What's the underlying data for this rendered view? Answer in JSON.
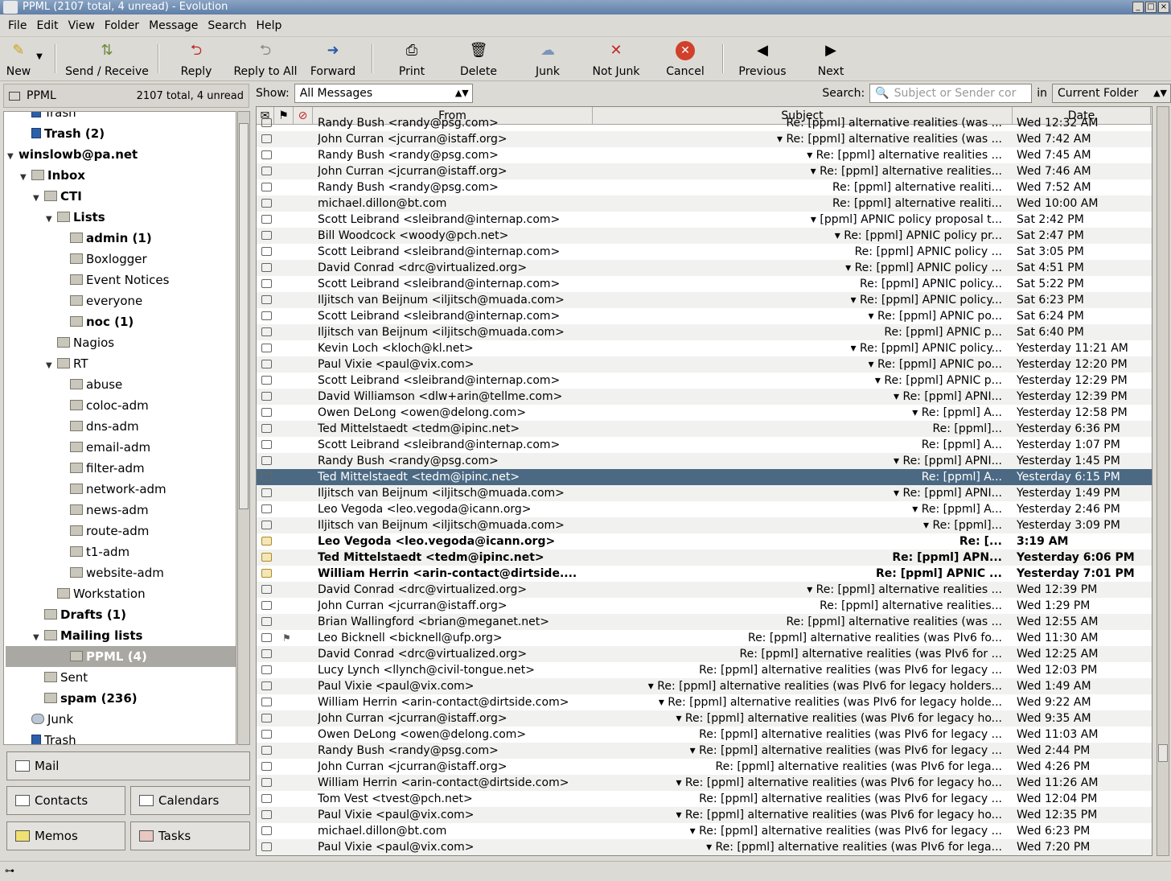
{
  "window": {
    "title": "PPML (2107 total, 4 unread) - Evolution"
  },
  "menu": [
    "File",
    "Edit",
    "View",
    "Folder",
    "Message",
    "Search",
    "Help"
  ],
  "toolbar": {
    "new": "New",
    "send_receive": "Send / Receive",
    "reply": "Reply",
    "reply_all": "Reply to All",
    "forward": "Forward",
    "print": "Print",
    "delete": "Delete",
    "junk": "Junk",
    "not_junk": "Not Junk",
    "cancel": "Cancel",
    "previous": "Previous",
    "next": "Next"
  },
  "folder_header": {
    "name": "PPML",
    "count": "2107 total, 4 unread"
  },
  "folders": [
    {
      "label": "Trash",
      "indent": 1,
      "bold": false,
      "icon": "trash-icon"
    },
    {
      "label": "Trash (2)",
      "indent": 1,
      "bold": true,
      "icon": "trash-icon"
    },
    {
      "label": "winslowb@pa.net",
      "indent": 0,
      "bold": true,
      "expander": "▼",
      "icon": ""
    },
    {
      "label": "Inbox",
      "indent": 1,
      "bold": true,
      "expander": "▼",
      "icon": "inbox-icon"
    },
    {
      "label": "CTI",
      "indent": 2,
      "bold": true,
      "expander": "▼",
      "icon": "folder-icon"
    },
    {
      "label": "Lists",
      "indent": 3,
      "bold": true,
      "expander": "▼",
      "icon": "folder-icon"
    },
    {
      "label": "admin (1)",
      "indent": 4,
      "bold": true,
      "icon": "folder-icon"
    },
    {
      "label": "Boxlogger",
      "indent": 4,
      "bold": false,
      "icon": "folder-icon"
    },
    {
      "label": "Event Notices",
      "indent": 4,
      "bold": false,
      "icon": "folder-icon"
    },
    {
      "label": "everyone",
      "indent": 4,
      "bold": false,
      "icon": "folder-icon"
    },
    {
      "label": "noc (1)",
      "indent": 4,
      "bold": true,
      "icon": "folder-icon"
    },
    {
      "label": "Nagios",
      "indent": 3,
      "bold": false,
      "icon": "folder-icon"
    },
    {
      "label": "RT",
      "indent": 3,
      "bold": false,
      "expander": "▼",
      "icon": "folder-icon"
    },
    {
      "label": "abuse",
      "indent": 4,
      "bold": false,
      "icon": "folder-icon"
    },
    {
      "label": "coloc-adm",
      "indent": 4,
      "bold": false,
      "icon": "folder-icon"
    },
    {
      "label": "dns-adm",
      "indent": 4,
      "bold": false,
      "icon": "folder-icon"
    },
    {
      "label": "email-adm",
      "indent": 4,
      "bold": false,
      "icon": "folder-icon"
    },
    {
      "label": "filter-adm",
      "indent": 4,
      "bold": false,
      "icon": "folder-icon"
    },
    {
      "label": "network-adm",
      "indent": 4,
      "bold": false,
      "icon": "folder-icon"
    },
    {
      "label": "news-adm",
      "indent": 4,
      "bold": false,
      "icon": "folder-icon"
    },
    {
      "label": "route-adm",
      "indent": 4,
      "bold": false,
      "icon": "folder-icon"
    },
    {
      "label": "t1-adm",
      "indent": 4,
      "bold": false,
      "icon": "folder-icon"
    },
    {
      "label": "website-adm",
      "indent": 4,
      "bold": false,
      "icon": "folder-icon"
    },
    {
      "label": "Workstation",
      "indent": 3,
      "bold": false,
      "icon": "folder-icon"
    },
    {
      "label": "Drafts (1)",
      "indent": 2,
      "bold": true,
      "icon": "folder-icon"
    },
    {
      "label": "Mailing lists",
      "indent": 2,
      "bold": true,
      "expander": "▼",
      "icon": "folder-icon"
    },
    {
      "label": "PPML (4)",
      "indent": 3,
      "bold": true,
      "icon": "folder-icon",
      "selected": true
    },
    {
      "label": "Sent",
      "indent": 2,
      "bold": false,
      "icon": "folder-icon"
    },
    {
      "label": "spam (236)",
      "indent": 2,
      "bold": true,
      "icon": "folder-icon"
    },
    {
      "label": "Junk",
      "indent": 1,
      "bold": false,
      "icon": "junk-icon"
    },
    {
      "label": "Trash",
      "indent": 1,
      "bold": false,
      "icon": "trash-icon"
    }
  ],
  "switcher": {
    "mail": "Mail",
    "contacts": "Contacts",
    "calendars": "Calendars",
    "memos": "Memos",
    "tasks": "Tasks"
  },
  "filter": {
    "show_label": "Show:",
    "show_value": "All Messages",
    "search_label": "Search:",
    "search_placeholder": "Subject or Sender cor",
    "in_label": "in",
    "scope_value": "Current Folder"
  },
  "columns": {
    "from": "From",
    "subject": "Subject",
    "date": "Date"
  },
  "messages": [
    {
      "from": "Randy Bush <randy@psg.com>",
      "subject": "Re: [ppml] alternative realities (was ...",
      "date": "Wed 12:32 AM",
      "thread": false
    },
    {
      "from": "John Curran <jcurran@istaff.org>",
      "subject": "Re: [ppml] alternative realities (was ...",
      "date": "Wed 7:42 AM",
      "thread": true
    },
    {
      "from": "Randy Bush <randy@psg.com>",
      "subject": "Re: [ppml] alternative realities ...",
      "date": "Wed 7:45 AM",
      "thread": true
    },
    {
      "from": "John Curran <jcurran@istaff.org>",
      "subject": "Re: [ppml] alternative realities...",
      "date": "Wed 7:46 AM",
      "thread": true
    },
    {
      "from": "Randy Bush <randy@psg.com>",
      "subject": "Re: [ppml] alternative realiti...",
      "date": "Wed 7:52 AM",
      "thread": false
    },
    {
      "from": "michael.dillon@bt.com",
      "subject": "Re: [ppml] alternative realiti...",
      "date": "Wed 10:00 AM",
      "thread": false
    },
    {
      "from": "Scott Leibrand <sleibrand@internap.com>",
      "subject": "[ppml] APNIC policy proposal t...",
      "date": "Sat 2:42 PM",
      "thread": true
    },
    {
      "from": "Bill Woodcock <woody@pch.net>",
      "subject": "Re: [ppml] APNIC policy pr...",
      "date": "Sat 2:47 PM",
      "thread": true
    },
    {
      "from": "Scott Leibrand <sleibrand@internap.com>",
      "subject": "Re: [ppml] APNIC policy ...",
      "date": "Sat 3:05 PM",
      "thread": false
    },
    {
      "from": "David Conrad <drc@virtualized.org>",
      "subject": "Re: [ppml] APNIC policy ...",
      "date": "Sat 4:51 PM",
      "thread": true
    },
    {
      "from": "Scott Leibrand <sleibrand@internap.com>",
      "subject": "Re: [ppml] APNIC policy...",
      "date": "Sat 5:22 PM",
      "thread": false
    },
    {
      "from": "Iljitsch van Beijnum <iljitsch@muada.com>",
      "subject": "Re: [ppml] APNIC policy...",
      "date": "Sat 6:23 PM",
      "thread": true
    },
    {
      "from": "Scott Leibrand <sleibrand@internap.com>",
      "subject": "Re: [ppml] APNIC po...",
      "date": "Sat 6:24 PM",
      "thread": true
    },
    {
      "from": "Iljitsch van Beijnum <iljitsch@muada.com>",
      "subject": "Re: [ppml] APNIC p...",
      "date": "Sat 6:40 PM",
      "thread": false
    },
    {
      "from": "Kevin Loch <kloch@kl.net>",
      "subject": "Re: [ppml] APNIC policy...",
      "date": "Yesterday 11:21 AM",
      "thread": true
    },
    {
      "from": "Paul Vixie <paul@vix.com>",
      "subject": "Re: [ppml] APNIC po...",
      "date": "Yesterday 12:20 PM",
      "thread": true
    },
    {
      "from": "Scott Leibrand <sleibrand@internap.com>",
      "subject": "Re: [ppml] APNIC p...",
      "date": "Yesterday 12:29 PM",
      "thread": true
    },
    {
      "from": "David Williamson <dlw+arin@tellme.com>",
      "subject": "Re: [ppml] APNI...",
      "date": "Yesterday 12:39 PM",
      "thread": true
    },
    {
      "from": "Owen DeLong <owen@delong.com>",
      "subject": "Re: [ppml] A...",
      "date": "Yesterday 12:58 PM",
      "thread": true
    },
    {
      "from": "Ted Mittelstaedt <tedm@ipinc.net>",
      "subject": "Re: [ppml]...",
      "date": "Yesterday 6:36 PM",
      "thread": false
    },
    {
      "from": "Scott Leibrand <sleibrand@internap.com>",
      "subject": "Re: [ppml] A...",
      "date": "Yesterday 1:07 PM",
      "thread": false
    },
    {
      "from": "Randy Bush <randy@psg.com>",
      "subject": "Re: [ppml] APNI...",
      "date": "Yesterday 1:45 PM",
      "thread": true
    },
    {
      "from": "Ted Mittelstaedt <tedm@ipinc.net>",
      "subject": "Re: [ppml] A...",
      "date": "Yesterday 6:15 PM",
      "thread": false,
      "selected": true
    },
    {
      "from": "Iljitsch van Beijnum <iljitsch@muada.com>",
      "subject": "Re: [ppml] APNI...",
      "date": "Yesterday 1:49 PM",
      "thread": true
    },
    {
      "from": "Leo Vegoda <leo.vegoda@icann.org>",
      "subject": "Re: [ppml] A...",
      "date": "Yesterday 2:46 PM",
      "thread": true
    },
    {
      "from": "Iljitsch van Beijnum <iljitsch@muada.com>",
      "subject": "Re: [ppml]...",
      "date": "Yesterday 3:09 PM",
      "thread": true
    },
    {
      "from": "Leo Vegoda <leo.vegoda@icann.org>",
      "subject": "Re: [...",
      "date": "3:19 AM",
      "thread": false,
      "unread": true
    },
    {
      "from": "Ted Mittelstaedt <tedm@ipinc.net>",
      "subject": "Re: [ppml] APN...",
      "date": "Yesterday 6:06 PM",
      "thread": false,
      "unread": true
    },
    {
      "from": "William Herrin <arin-contact@dirtside....",
      "subject": "Re: [ppml] APNIC ...",
      "date": "Yesterday 7:01 PM",
      "thread": false,
      "unread": true
    },
    {
      "from": "David Conrad <drc@virtualized.org>",
      "subject": "Re: [ppml] alternative realities ...",
      "date": "Wed 12:39 PM",
      "thread": true
    },
    {
      "from": "John Curran <jcurran@istaff.org>",
      "subject": "Re: [ppml] alternative realities...",
      "date": "Wed 1:29 PM",
      "thread": false
    },
    {
      "from": "Brian Wallingford <brian@meganet.net>",
      "subject": "Re: [ppml] alternative realities (was ...",
      "date": "Wed 12:55 AM",
      "thread": false
    },
    {
      "from": "Leo Bicknell <bicknell@ufp.org>",
      "subject": "Re: [ppml] alternative realities (was PIv6 fo...",
      "date": "Wed 11:30 AM",
      "thread": false,
      "flagged": true
    },
    {
      "from": "David Conrad <drc@virtualized.org>",
      "subject": "Re: [ppml] alternative realities (was PIv6 for ...",
      "date": "Wed 12:25 AM",
      "thread": false
    },
    {
      "from": "Lucy Lynch <llynch@civil-tongue.net>",
      "subject": "Re: [ppml] alternative realities (was PIv6 for legacy ...",
      "date": "Wed 12:03 PM",
      "thread": false
    },
    {
      "from": "Paul Vixie <paul@vix.com>",
      "subject": "Re: [ppml] alternative realities (was PIv6 for legacy holders...",
      "date": "Wed 1:49 AM",
      "thread": true
    },
    {
      "from": "William Herrin <arin-contact@dirtside.com>",
      "subject": "Re: [ppml] alternative realities (was PIv6 for legacy holde...",
      "date": "Wed 9:22 AM",
      "thread": true
    },
    {
      "from": "John Curran <jcurran@istaff.org>",
      "subject": "Re: [ppml] alternative realities (was PIv6 for legacy ho...",
      "date": "Wed 9:35 AM",
      "thread": true
    },
    {
      "from": "Owen DeLong <owen@delong.com>",
      "subject": "Re: [ppml] alternative realities (was PIv6 for legacy ...",
      "date": "Wed 11:03 AM",
      "thread": false
    },
    {
      "from": "Randy Bush <randy@psg.com>",
      "subject": "Re: [ppml] alternative realities (was PIv6 for legacy ...",
      "date": "Wed 2:44 PM",
      "thread": true
    },
    {
      "from": "John Curran <jcurran@istaff.org>",
      "subject": "Re: [ppml] alternative realities (was PIv6 for lega...",
      "date": "Wed 4:26 PM",
      "thread": false
    },
    {
      "from": "William Herrin <arin-contact@dirtside.com>",
      "subject": "Re: [ppml] alternative realities (was PIv6 for legacy ho...",
      "date": "Wed 11:26 AM",
      "thread": true
    },
    {
      "from": "Tom Vest <tvest@pch.net>",
      "subject": "Re: [ppml] alternative realities (was PIv6 for legacy ...",
      "date": "Wed 12:04 PM",
      "thread": false
    },
    {
      "from": "Paul Vixie <paul@vix.com>",
      "subject": "Re: [ppml] alternative realities (was PIv6 for legacy ho...",
      "date": "Wed 12:35 PM",
      "thread": true
    },
    {
      "from": "michael.dillon@bt.com",
      "subject": "Re: [ppml] alternative realities (was PIv6 for legacy ...",
      "date": "Wed 6:23 PM",
      "thread": true
    },
    {
      "from": "Paul Vixie <paul@vix.com>",
      "subject": "Re: [ppml] alternative realities (was PIv6 for lega...",
      "date": "Wed 7:20 PM",
      "thread": true
    }
  ],
  "colors": {
    "selection": "#4b6983",
    "titlebar": "#6f8db5"
  }
}
